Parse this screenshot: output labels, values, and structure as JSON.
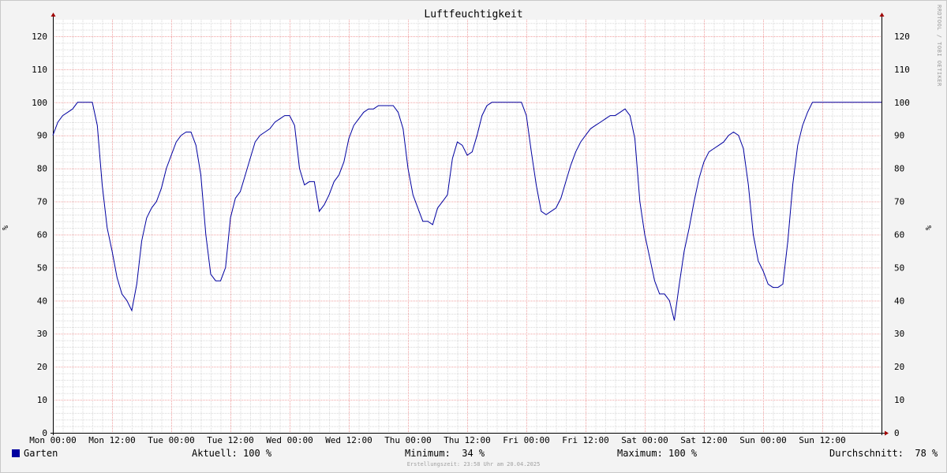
{
  "title": "Luftfeuchtigkeit",
  "watermark": "RRDTOOL / TOBI OETIKER",
  "footer": "Erstellungszeit: 23:58 Uhr am 20.04.2025",
  "legend": {
    "series_name": "Garten",
    "aktuell": "Aktuell: 100 %",
    "minimum": "Minimum:  34 %",
    "maximum": "Maximum: 100 %",
    "durchschnitt": "Durchschnitt:  78 %"
  },
  "colors": {
    "line": "#0000a0",
    "major_grid": "#f0a0a0",
    "minor_grid": "#d8d8d8",
    "background": "#f3f3f3",
    "plot": "#ffffff"
  },
  "chart_data": {
    "type": "line",
    "title": "Luftfeuchtigkeit",
    "ylabel": "%",
    "y_right_label": "%",
    "ylim": [
      0,
      125
    ],
    "xlim_hours": [
      0,
      168
    ],
    "x_ticks": [
      "Mon 00:00",
      "Mon 12:00",
      "Tue 00:00",
      "Tue 12:00",
      "Wed 00:00",
      "Wed 12:00",
      "Thu 00:00",
      "Thu 12:00",
      "Fri 00:00",
      "Fri 12:00",
      "Sat 00:00",
      "Sat 12:00",
      "Sun 00:00",
      "Sun 12:00"
    ],
    "y_ticks": [
      0,
      10,
      20,
      30,
      40,
      50,
      60,
      70,
      80,
      90,
      100,
      110,
      120
    ],
    "grid": true,
    "series": [
      {
        "name": "Garten",
        "x": [
          0,
          1,
          2,
          3,
          4,
          5,
          6,
          7,
          8,
          9,
          10,
          11,
          12,
          13,
          14,
          15,
          16,
          17,
          18,
          19,
          20,
          21,
          22,
          23,
          24,
          25,
          26,
          27,
          28,
          29,
          30,
          31,
          32,
          33,
          34,
          35,
          36,
          37,
          38,
          39,
          40,
          41,
          42,
          43,
          44,
          45,
          46,
          47,
          48,
          49,
          50,
          51,
          52,
          53,
          54,
          55,
          56,
          57,
          58,
          59,
          60,
          61,
          62,
          63,
          64,
          65,
          66,
          67,
          68,
          69,
          70,
          71,
          72,
          73,
          74,
          75,
          76,
          77,
          78,
          79,
          80,
          81,
          82,
          83,
          84,
          85,
          86,
          87,
          88,
          89,
          90,
          91,
          92,
          93,
          94,
          95,
          96,
          97,
          98,
          99,
          100,
          101,
          102,
          103,
          104,
          105,
          106,
          107,
          108,
          109,
          110,
          111,
          112,
          113,
          114,
          115,
          116,
          117,
          118,
          119,
          120,
          121,
          122,
          123,
          124,
          125,
          126,
          127,
          128,
          129,
          130,
          131,
          132,
          133,
          134,
          135,
          136,
          137,
          138,
          139,
          140,
          141,
          142,
          143,
          144,
          145,
          146,
          147,
          148,
          149,
          150,
          151,
          152,
          153,
          154,
          155,
          156,
          157,
          158,
          159,
          160,
          161,
          162,
          163,
          164,
          165,
          166,
          167,
          168
        ],
        "values": [
          90,
          94,
          96,
          97,
          98,
          100,
          100,
          100,
          100,
          93,
          75,
          62,
          55,
          47,
          42,
          40,
          37,
          45,
          58,
          65,
          68,
          70,
          74,
          80,
          84,
          88,
          90,
          91,
          91,
          87,
          78,
          60,
          48,
          46,
          46,
          50,
          65,
          71,
          73,
          78,
          83,
          88,
          90,
          91,
          92,
          94,
          95,
          96,
          96,
          93,
          80,
          75,
          76,
          76,
          67,
          69,
          72,
          76,
          78,
          82,
          89,
          93,
          95,
          97,
          98,
          98,
          99,
          99,
          99,
          99,
          97,
          92,
          80,
          72,
          68,
          64,
          64,
          63,
          68,
          70,
          72,
          83,
          88,
          87,
          84,
          85,
          90,
          96,
          99,
          100,
          100,
          100,
          100,
          100,
          100,
          100,
          96,
          85,
          75,
          67,
          66,
          67,
          68,
          71,
          76,
          81,
          85,
          88,
          90,
          92,
          93,
          94,
          95,
          96,
          96,
          97,
          98,
          96,
          89,
          70,
          60,
          53,
          46,
          42,
          42,
          40,
          34,
          45,
          55,
          62,
          70,
          77,
          82,
          85,
          86,
          87,
          88,
          90,
          91,
          90,
          86,
          75,
          60,
          52,
          49,
          45,
          44,
          44,
          45,
          58,
          75,
          87,
          93,
          97,
          100,
          100,
          100,
          100,
          100,
          100,
          100,
          100,
          100,
          100,
          100,
          100,
          100,
          100,
          100
        ]
      }
    ]
  }
}
